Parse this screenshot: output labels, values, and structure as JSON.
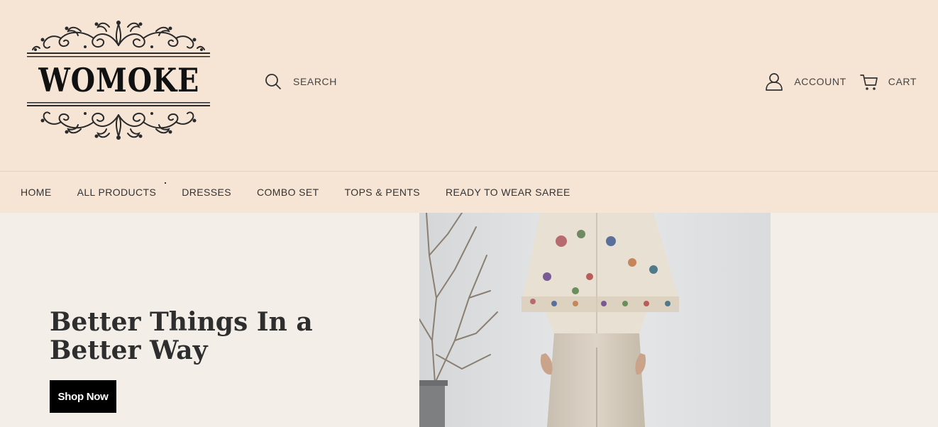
{
  "brand": {
    "name": "WOMOKE"
  },
  "header": {
    "search_label": "SEARCH",
    "account_label": "ACCOUNT",
    "cart_label": "CART",
    "icons": {
      "search": "search-icon",
      "account": "user-icon",
      "cart": "cart-icon"
    }
  },
  "nav": {
    "items": [
      {
        "label": "HOME"
      },
      {
        "label": "ALL PRODUCTS"
      },
      {
        "label": "DRESSES"
      },
      {
        "label": "COMBO SET"
      },
      {
        "label": "TOPS & PENTS"
      },
      {
        "label": "READY TO WEAR SAREE"
      }
    ]
  },
  "hero": {
    "title": "Better Things In a Better Way",
    "cta_label": "Shop Now"
  },
  "colors": {
    "header_bg": "#f6e5d5",
    "hero_bg": "#f3eee8",
    "cta_bg": "#000000",
    "cta_text": "#ffffff"
  }
}
